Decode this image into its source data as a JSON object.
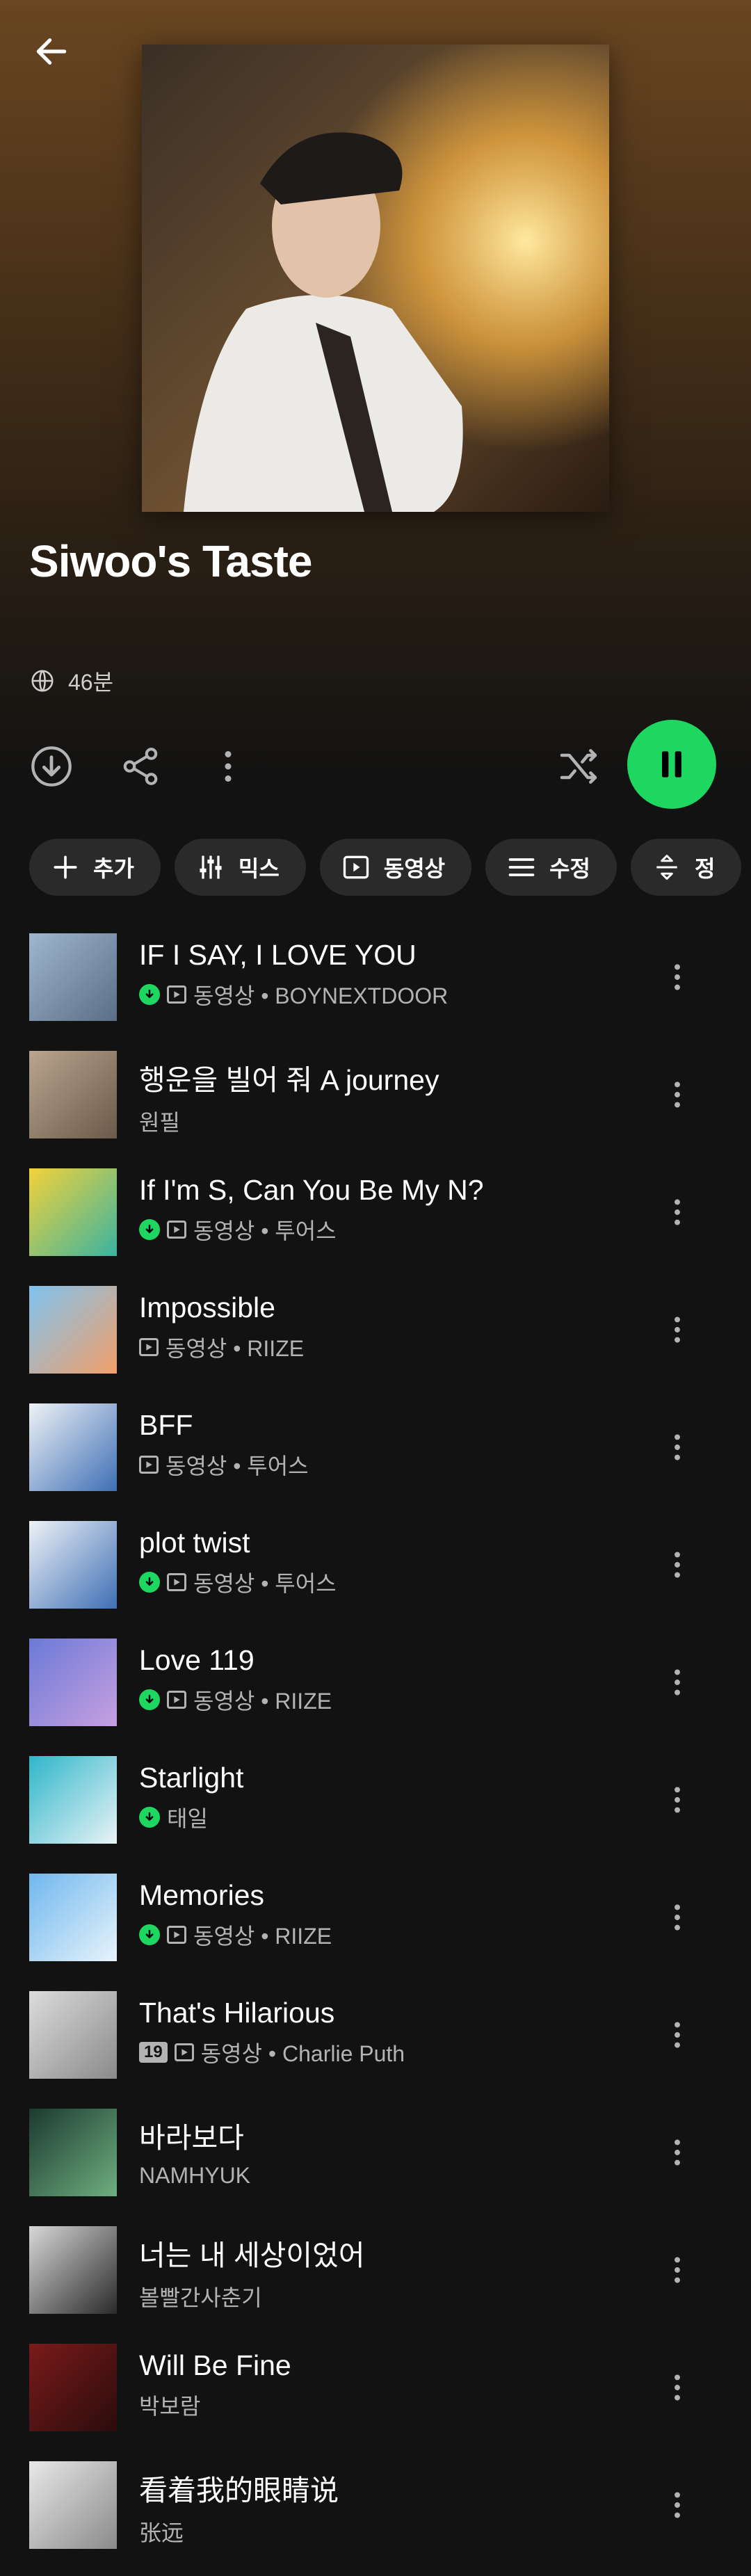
{
  "playlist": {
    "title": "Siwoo's Taste",
    "duration": "46분"
  },
  "colors": {
    "accent": "#1ed760",
    "background": "#121212",
    "header": "#6a4621"
  },
  "chips": [
    {
      "icon": "plus-icon",
      "label": "추가"
    },
    {
      "icon": "sliders-icon",
      "label": "믹스"
    },
    {
      "icon": "video-icon",
      "label": "동영상"
    },
    {
      "icon": "edit-lines-icon",
      "label": "수정"
    },
    {
      "icon": "sort-icon",
      "label": "정"
    }
  ],
  "tracks": [
    {
      "title": "IF I SAY, I LOVE YOU",
      "subtitle": "동영상 • BOYNEXTDOOR",
      "downloaded": true,
      "video": true,
      "explicit": ""
    },
    {
      "title": "행운을 빌어 줘 A journey",
      "subtitle": "원필",
      "downloaded": false,
      "video": false,
      "explicit": ""
    },
    {
      "title": "If I'm S, Can You Be My N?",
      "subtitle": "동영상 • 투어스",
      "downloaded": true,
      "video": true,
      "explicit": ""
    },
    {
      "title": "Impossible",
      "subtitle": "동영상 • RIIZE",
      "downloaded": false,
      "video": true,
      "explicit": ""
    },
    {
      "title": "BFF",
      "subtitle": "동영상 • 투어스",
      "downloaded": false,
      "video": true,
      "explicit": ""
    },
    {
      "title": "plot twist",
      "subtitle": "동영상 • 투어스",
      "downloaded": true,
      "video": true,
      "explicit": ""
    },
    {
      "title": "Love 119",
      "subtitle": "동영상 • RIIZE",
      "downloaded": true,
      "video": true,
      "explicit": ""
    },
    {
      "title": "Starlight",
      "subtitle": "태일",
      "downloaded": true,
      "video": false,
      "explicit": ""
    },
    {
      "title": "Memories",
      "subtitle": "동영상 • RIIZE",
      "downloaded": true,
      "video": true,
      "explicit": ""
    },
    {
      "title": "That's Hilarious",
      "subtitle": "동영상 • Charlie Puth",
      "downloaded": false,
      "video": true,
      "explicit": "19"
    },
    {
      "title": "바라보다",
      "subtitle": "NAMHYUK",
      "downloaded": false,
      "video": false,
      "explicit": ""
    },
    {
      "title": "너는 내 세상이었어",
      "subtitle": "볼빨간사춘기",
      "downloaded": false,
      "video": false,
      "explicit": ""
    },
    {
      "title": "Will Be Fine",
      "subtitle": "박보람",
      "downloaded": false,
      "video": false,
      "explicit": ""
    },
    {
      "title": "看着我的眼睛说",
      "subtitle": "张远",
      "downloaded": false,
      "video": false,
      "explicit": ""
    }
  ]
}
